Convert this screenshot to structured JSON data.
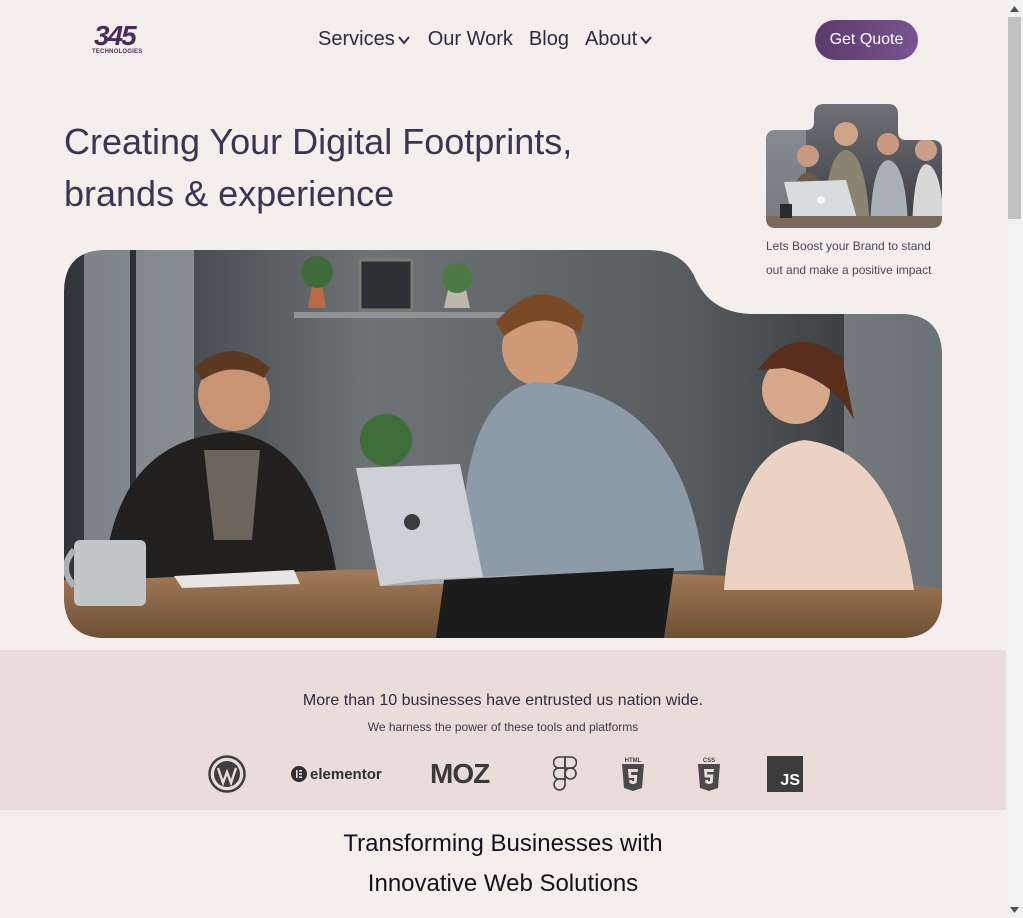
{
  "header": {
    "logo_text": "345",
    "logo_sub": "TECHNOLOGIES",
    "nav": [
      {
        "label": "Services",
        "has_dropdown": true
      },
      {
        "label": "Our Work",
        "has_dropdown": false
      },
      {
        "label": "Blog",
        "has_dropdown": false
      },
      {
        "label": "About",
        "has_dropdown": true
      }
    ],
    "cta_label": "Get Quote"
  },
  "hero": {
    "title_line1": "Creating Your Digital Footprints,",
    "title_line2": "brands & experience",
    "caption_line1": "Lets Boost your Brand to stand",
    "caption_line2": "out and make a positive impact"
  },
  "trust": {
    "title": "More than 10 businesses have entrusted us nation wide.",
    "subtitle": "We harness the power of these tools and platforms",
    "tools": [
      {
        "name": "wordpress-icon"
      },
      {
        "name": "elementor",
        "label": "elementor"
      },
      {
        "name": "moz",
        "label": "MOZ"
      },
      {
        "name": "figma-icon"
      },
      {
        "name": "html5",
        "label": "HTML"
      },
      {
        "name": "css3",
        "label": "CSS"
      },
      {
        "name": "javascript",
        "label": "JS"
      }
    ]
  },
  "section": {
    "title_line1": "Transforming Businesses with",
    "title_line2": "Innovative Web Solutions"
  },
  "colors": {
    "accent": "#5a3b6b",
    "band_bg": "#eaddd9",
    "page_bg": "#f4efed"
  }
}
